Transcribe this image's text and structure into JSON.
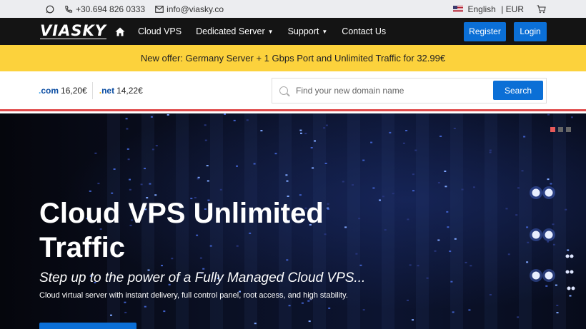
{
  "topbar": {
    "phone": "+30.694 826 0333",
    "email": "info@viasky.co",
    "language": "English",
    "currency": "EUR"
  },
  "navbar": {
    "logo": "VIASKY",
    "items": [
      {
        "label": "Cloud VPS",
        "dropdown": false
      },
      {
        "label": "Dedicated Server",
        "dropdown": true
      },
      {
        "label": "Support",
        "dropdown": true
      },
      {
        "label": "Contact Us",
        "dropdown": false
      }
    ],
    "register_label": "Register",
    "login_label": "Login"
  },
  "offer": {
    "text": "New offer: Germany Server + 1 Gbps Port and Unlimited Traffic for 32.99€"
  },
  "domain": {
    "tlds": [
      {
        "name": "com",
        "price": "16,20€"
      },
      {
        "name": "net",
        "price": "14,22€"
      }
    ],
    "search_placeholder": "Find your new domain name",
    "search_label": "Search"
  },
  "hero": {
    "title": "Cloud VPS Unlimited Traffic",
    "subtitle": "Step up to the power of a Fully Managed Cloud VPS...",
    "description": "Cloud virtual server with instant delivery, full control panel, root access, and high stability.",
    "slides": 3,
    "active_slide": 1
  },
  "colors": {
    "accent": "#0b6fd6",
    "offer_bg": "#fcd23c",
    "navbar_bg": "#141414",
    "divider": "#e04a4a"
  }
}
